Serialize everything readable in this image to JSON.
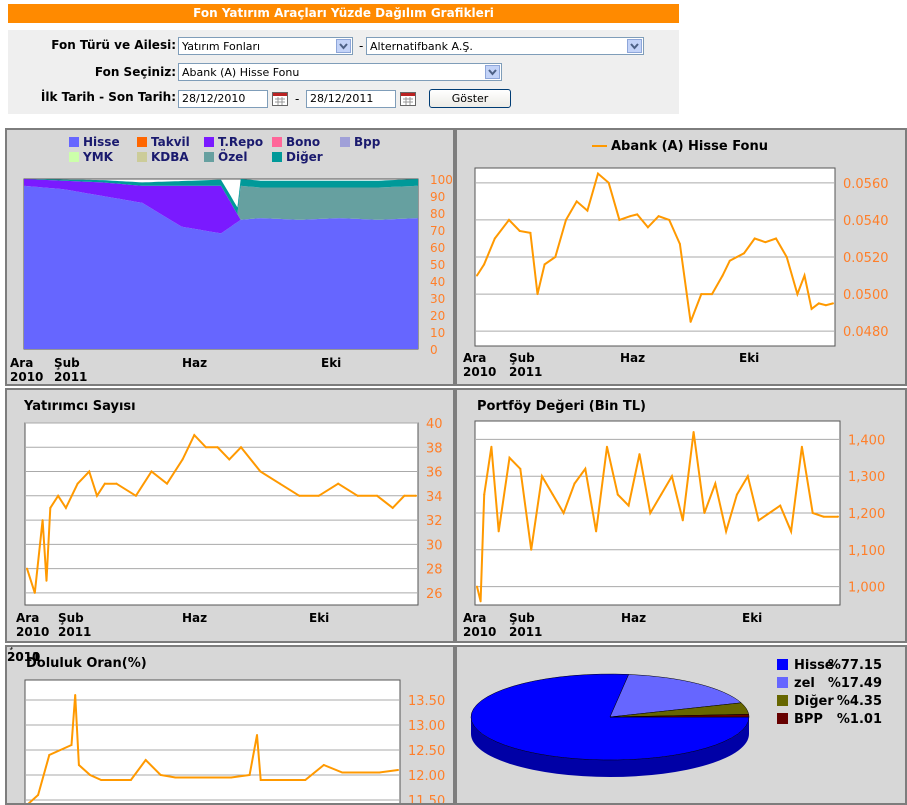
{
  "page": {
    "title": "Fon Yatırım Araçları Yüzde Dağılım Grafikleri"
  },
  "form": {
    "fund_type_label": "Fon Türü ve Ailesi:",
    "fund_type_value": "Yatırım Fonları",
    "family_value": "Alternatifbank A.Ş.",
    "fund_label": "Fon Seçiniz:",
    "fund_value": "Abank (A) Hisse Fonu",
    "date_label": "İlk Tarih - Son Tarih:",
    "start_date": "28/12/2010",
    "end_date": "28/12/2011",
    "dash": "-",
    "show_button": "Göster"
  },
  "colors": {
    "orange": "#FF9900",
    "header": "#FF8A00",
    "panel_bg": "#D7D7D7",
    "grid": "#AAAAAA",
    "axis_text": "#FF7F2A"
  },
  "x_ticks": [
    {
      "line1": "Ara",
      "line2": "2010"
    },
    {
      "line1": "Şub",
      "line2": "2011"
    },
    {
      "line1": "Haz",
      "line2": ""
    },
    {
      "line1": "Eki",
      "line2": ""
    }
  ],
  "chart_data": [
    {
      "type": "area",
      "title": "",
      "legend": [
        {
          "name": "Hisse",
          "color": "#6666FF"
        },
        {
          "name": "Takvil",
          "color": "#FF6600"
        },
        {
          "name": "T.Repo",
          "color": "#7A1AFF"
        },
        {
          "name": "Bono",
          "color": "#FF6699"
        },
        {
          "name": "Bpp",
          "color": "#A0A0D8"
        },
        {
          "name": "YMK",
          "color": "#CCFFAA"
        },
        {
          "name": "KDBA",
          "color": "#CCCC99"
        },
        {
          "name": "Özel",
          "color": "#66A0A0"
        },
        {
          "name": "Diğer",
          "color": "#009999"
        }
      ],
      "y_ticks": [
        0,
        10,
        20,
        30,
        40,
        50,
        60,
        70,
        80,
        90,
        100
      ],
      "ylim": [
        0,
        100
      ],
      "series": [
        {
          "name": "Hisse",
          "x": [
            0,
            0.1,
            0.2,
            0.3,
            0.4,
            0.5,
            0.55,
            0.6,
            0.7,
            0.8,
            0.9,
            1.0
          ],
          "values": [
            96,
            94,
            90,
            86,
            72,
            68,
            76,
            77,
            76,
            77,
            76,
            77
          ]
        },
        {
          "name": "T.Repo",
          "x": [
            0,
            0.1,
            0.2,
            0.3,
            0.4,
            0.5,
            0.55
          ],
          "values": [
            4,
            5,
            8,
            10,
            24,
            28,
            0
          ]
        },
        {
          "name": "Özel",
          "x": [
            0.55,
            0.6,
            0.7,
            0.8,
            0.9,
            1.0
          ],
          "values": [
            20,
            18,
            19,
            18,
            19,
            19
          ]
        },
        {
          "name": "Diğer",
          "x": [
            0,
            0.3,
            0.55,
            0.7,
            1.0
          ],
          "values": [
            0,
            2,
            4,
            4,
            4
          ]
        }
      ]
    },
    {
      "type": "line",
      "title": "Abank (A) Hisse Fonu",
      "legend": [
        "Abank (A) Hisse Fonu"
      ],
      "y_ticks": [
        "0.0480",
        "0.0500",
        "0.0520",
        "0.0540",
        "0.0560"
      ],
      "ylim": [
        0.0472,
        0.0568
      ],
      "x": [
        0,
        0.02,
        0.05,
        0.09,
        0.12,
        0.15,
        0.17,
        0.19,
        0.22,
        0.25,
        0.28,
        0.31,
        0.34,
        0.37,
        0.4,
        0.43,
        0.45,
        0.48,
        0.51,
        0.54,
        0.57,
        0.6,
        0.63,
        0.66,
        0.69,
        0.71,
        0.73,
        0.75,
        0.78,
        0.81,
        0.84,
        0.87,
        0.9,
        0.92,
        0.94,
        0.96,
        0.98,
        1.0
      ],
      "values": [
        0.051,
        0.0516,
        0.053,
        0.054,
        0.0534,
        0.0533,
        0.05,
        0.0516,
        0.052,
        0.054,
        0.055,
        0.0545,
        0.0565,
        0.056,
        0.054,
        0.0542,
        0.0543,
        0.0536,
        0.0542,
        0.054,
        0.0527,
        0.0485,
        0.05,
        0.05,
        0.051,
        0.0518,
        0.052,
        0.0522,
        0.053,
        0.0528,
        0.053,
        0.052,
        0.05,
        0.051,
        0.0492,
        0.0495,
        0.0494,
        0.0495
      ]
    },
    {
      "type": "line",
      "title": "Yatırımcı Sayısı",
      "y_ticks": [
        26,
        28,
        30,
        32,
        34,
        36,
        38,
        40
      ],
      "ylim": [
        25,
        40
      ],
      "x": [
        0,
        0.02,
        0.04,
        0.05,
        0.06,
        0.08,
        0.1,
        0.13,
        0.16,
        0.18,
        0.2,
        0.23,
        0.28,
        0.32,
        0.36,
        0.4,
        0.43,
        0.46,
        0.49,
        0.52,
        0.55,
        0.6,
        0.65,
        0.7,
        0.75,
        0.8,
        0.85,
        0.9,
        0.94,
        0.97,
        1.0
      ],
      "values": [
        28,
        26,
        32,
        27,
        33,
        34,
        33,
        35,
        36,
        34,
        35,
        35,
        34,
        36,
        35,
        37,
        39,
        38,
        38,
        37,
        38,
        36,
        35,
        34,
        34,
        35,
        34,
        34,
        33,
        34,
        34
      ]
    },
    {
      "type": "line",
      "title": "Portföy Değeri (Bin TL)",
      "y_ticks": [
        "1,000",
        "1,100",
        "1,200",
        "1,300",
        "1,400"
      ],
      "ylim": [
        950,
        1450
      ],
      "x": [
        0,
        0.01,
        0.02,
        0.04,
        0.06,
        0.09,
        0.12,
        0.15,
        0.18,
        0.21,
        0.24,
        0.27,
        0.3,
        0.33,
        0.36,
        0.39,
        0.42,
        0.45,
        0.48,
        0.51,
        0.54,
        0.57,
        0.6,
        0.63,
        0.66,
        0.69,
        0.72,
        0.75,
        0.78,
        0.81,
        0.84,
        0.87,
        0.9,
        0.93,
        0.96,
        1.0
      ],
      "values": [
        1000,
        960,
        1250,
        1380,
        1150,
        1350,
        1320,
        1100,
        1300,
        1250,
        1200,
        1280,
        1320,
        1150,
        1380,
        1250,
        1220,
        1360,
        1200,
        1250,
        1300,
        1180,
        1420,
        1200,
        1280,
        1150,
        1250,
        1300,
        1180,
        1200,
        1220,
        1150,
        1380,
        1200,
        1190,
        1190
      ]
    },
    {
      "type": "line",
      "title": "Doluluk Oran(%)",
      "y_ticks": [
        "11.50",
        "12.00",
        "12.50",
        "13.00",
        "13.50"
      ],
      "ylim": [
        11.3,
        13.9
      ],
      "x": [
        0,
        0.03,
        0.06,
        0.09,
        0.12,
        0.13,
        0.14,
        0.17,
        0.2,
        0.24,
        0.28,
        0.32,
        0.36,
        0.4,
        0.45,
        0.5,
        0.55,
        0.6,
        0.62,
        0.63,
        0.65,
        0.7,
        0.75,
        0.8,
        0.85,
        0.9,
        0.95,
        1.0
      ],
      "values": [
        11.4,
        11.6,
        12.4,
        12.5,
        12.6,
        13.6,
        12.2,
        12.0,
        11.9,
        11.9,
        11.9,
        12.3,
        12.0,
        11.95,
        11.95,
        11.95,
        11.95,
        12.0,
        12.8,
        11.9,
        11.9,
        11.9,
        11.9,
        12.2,
        12.05,
        12.05,
        12.05,
        12.1
      ]
    },
    {
      "type": "pie",
      "title": "",
      "slices": [
        {
          "name": "Hisse",
          "value": 77.15,
          "label": "%77.15",
          "color": "#0000FF"
        },
        {
          "name": "zel",
          "value": 17.49,
          "label": "%17.49",
          "color": "#6666FF"
        },
        {
          "name": "Diğer",
          "value": 4.35,
          "label": "%4.35",
          "color": "#666600"
        },
        {
          "name": "BPP",
          "value": 1.01,
          "label": "%1.01",
          "color": "#660000"
        }
      ]
    }
  ]
}
